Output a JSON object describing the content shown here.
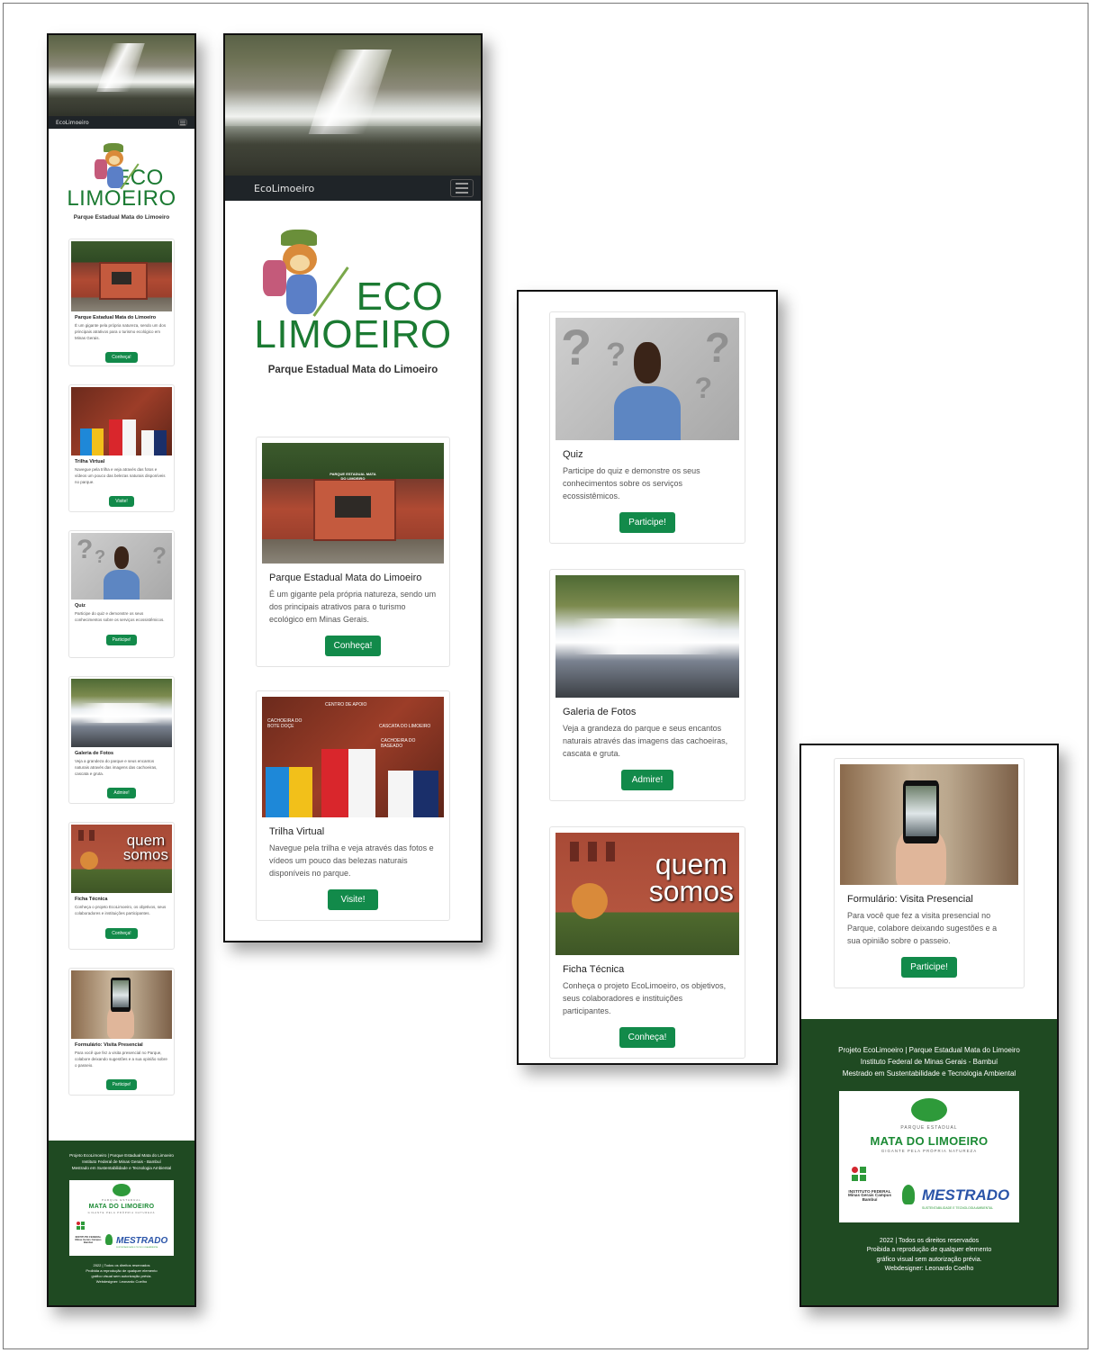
{
  "brand": "EcoLimoeiro",
  "logo": {
    "line1": "ECO",
    "line2": "LIMOEIRO",
    "subtitle": "Parque Estadual Mata do Limoeiro"
  },
  "cards": [
    {
      "title": "Parque Estadual Mata do Limoeiro",
      "text": "É um gigante pela própria natureza, sendo um dos principais atrativos para o turismo ecológico em Minas Gerais.",
      "button": "Conheça!",
      "image_sign": "PARQUE ESTADUAL MATA DO LIMOEIRO"
    },
    {
      "title": "Trilha Virtual",
      "text": "Navegue pela trilha e veja através das fotos e vídeos um pouco das belezas naturais disponíveis no parque.",
      "button": "Visite!",
      "image_labels": [
        "CENTRO DE APOIO",
        "CACHOEIRA DO BOTE DOÇE",
        "CASCATA DO LIMOEIRO",
        "CACHOEIRA DO BASEADO"
      ]
    },
    {
      "title": "Quiz",
      "text": "Participe do quiz e demonstre os seus conhecimentos sobre os serviços ecossistêmicos.",
      "button": "Participe!"
    },
    {
      "title": "Galeria de Fotos",
      "text": "Veja a grandeza do parque e seus encantos naturais através das imagens das cachoeiras, cascata e gruta.",
      "button": "Admire!"
    },
    {
      "title": "Ficha Técnica",
      "text": "Conheça o projeto EcoLimoeiro, os objetivos, seus colaboradores e instituições participantes.",
      "button": "Conheça!",
      "image_text": [
        "quem",
        "somos"
      ]
    },
    {
      "title": "Formulário: Visita Presencial",
      "text": "Para você que fez a visita presencial no Parque, colabore deixando sugestões e a sua opinião sobre o passeio.",
      "button": "Participe!"
    }
  ],
  "footer": {
    "lines": [
      "Projeto EcoLimoeiro | Parque Estadual Mata do Limoeiro",
      "Instituto Federal de Minas Gerais - Bambuí",
      "Mestrado em Sustentabilidade e Tecnologia Ambiental"
    ],
    "logo_park_top": "PARQUE ESTADUAL",
    "logo_park_name": "MATA DO LIMOEIRO",
    "logo_park_tagline": "GIGANTE PELA PRÓPRIA NATUREZA",
    "logo_if": "INSTITUTO FEDERAL Minas Gerais Campus Bambuí",
    "logo_mestrado": "MESTRADO",
    "logo_mestrado_sub": "SUSTENTABILIDADE E TECNOLOGIA AMBIENTAL",
    "rights": [
      "2022 | Todos os direitos reservados",
      "Proibida a reprodução de qualquer elemento",
      "gráfico visual sem autorização prévia.",
      "Webdesigner: Leonardo Coelho"
    ]
  },
  "colors": {
    "green_button": "#128a4a",
    "footer_green": "#1f4a22",
    "logo_green": "#1b7a32",
    "navbar": "#1f2428"
  },
  "icons": [
    "menu-toggler-icon"
  ]
}
